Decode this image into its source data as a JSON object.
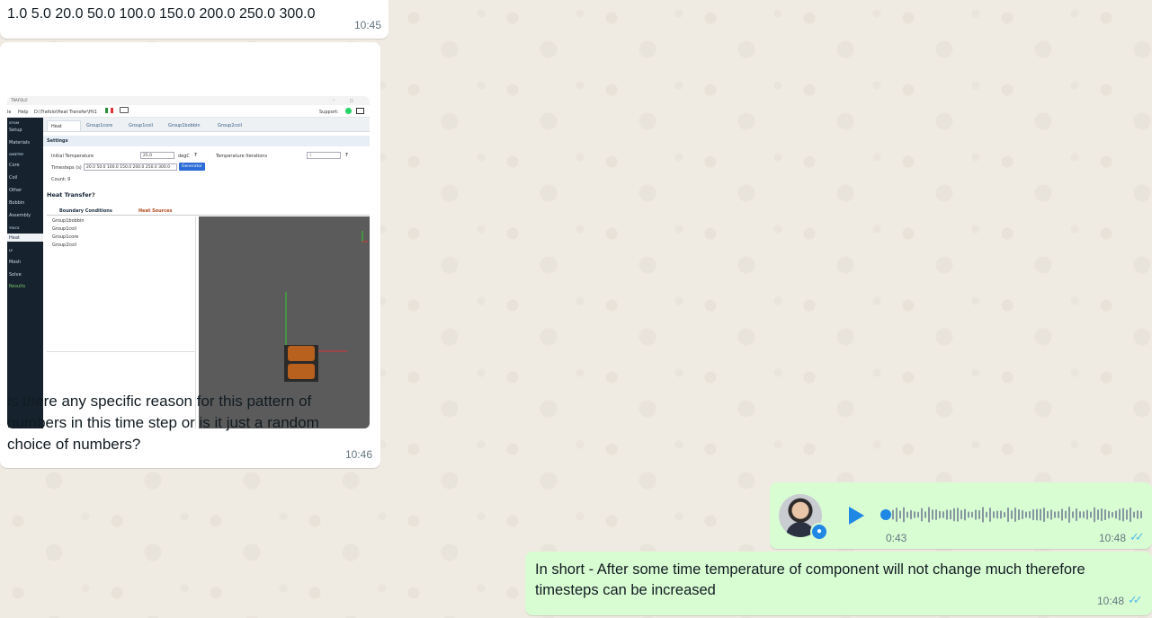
{
  "messages": {
    "m1": {
      "text": "1.0 5.0 20.0 50.0 100.0 150.0 200.0 250.0 300.0",
      "time": "10:45"
    },
    "m2": {
      "text": "is there any specific reason for this pattern of numbers in this time step or is it just a random choice of numbers?",
      "time": "10:46",
      "screenshot": {
        "title": "TRAFOLO",
        "menu": {
          "file": "le",
          "help": "Help",
          "path": "D:\\Trafolo\\Heat Transfer\\Ht1",
          "support": "Support:"
        },
        "sidebar": {
          "sections": [
            "STOM",
            "OMETRY",
            "YSICS",
            "LY"
          ],
          "items": [
            "Setup",
            "Materials",
            "Core",
            "Coil",
            "Other",
            "Bobbin",
            "Assembly",
            "Heat",
            "Mesh",
            "Solve",
            "Results"
          ]
        },
        "tabs": [
          "Heat",
          "Group1core",
          "Group1coil",
          "Group1bobbin",
          "Group2coil"
        ],
        "settings": {
          "header": "Settings",
          "initial_temp_label": "Initial Temperature",
          "initial_temp_value": "25.0",
          "unit": "degC",
          "help": "?",
          "iterations_label": "Temperature Iterations",
          "iterations_value": "1",
          "timesteps_label": "Timesteps (s)",
          "timesteps_value": "20.0 50.0 100.0 150.0 200.0 250.0 300.0",
          "generator": "Generator",
          "count": "Count: 9"
        },
        "heat_transfer": "Heat Transfer",
        "subtabs": [
          "Boundary Conditions",
          "Heat Sources"
        ],
        "tree": [
          "Group1bobbin",
          "Group1coil",
          "Group1core",
          "Group2coil"
        ]
      }
    },
    "m3": {
      "duration": "0:43",
      "time": "10:48"
    },
    "m4": {
      "text": "In short - After some time temperature of component will not change much therefore timesteps can be increased",
      "time": "10:48"
    }
  },
  "colors": {
    "incoming": "#ffffff",
    "outgoing": "#d9fdd3",
    "accent": "#1f88e5",
    "read_ticks": "#53bdeb"
  }
}
